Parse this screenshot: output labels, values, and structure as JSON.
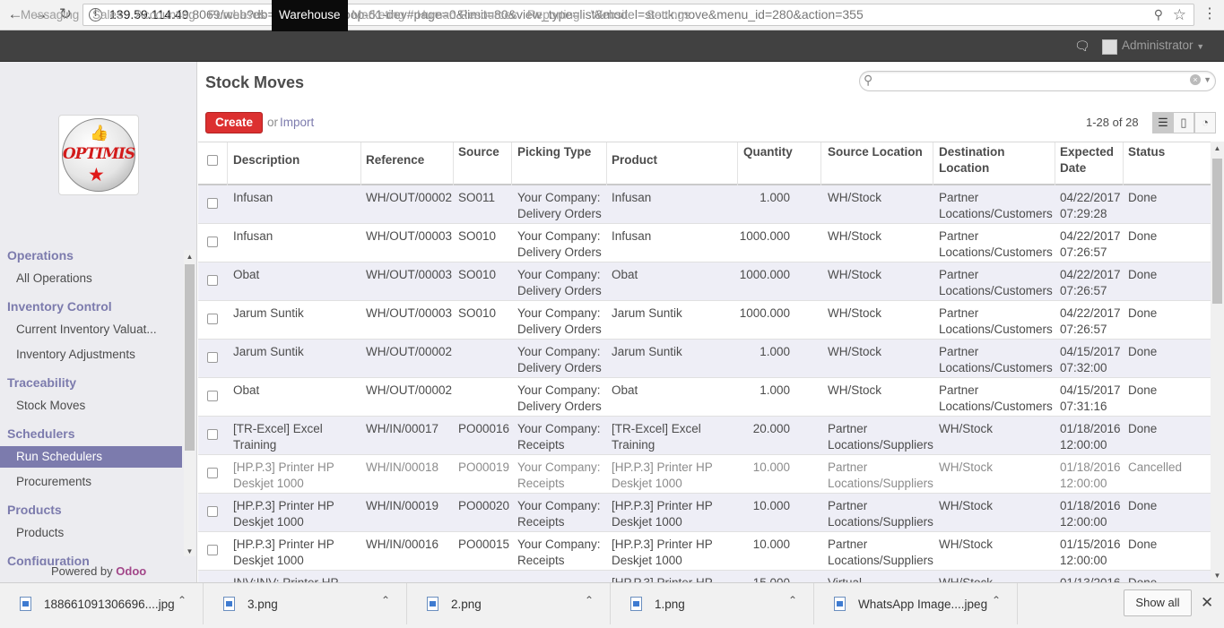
{
  "browser": {
    "url_host": "139.59.114.49",
    "url_rest": ":8069/web?db=o8-uperp10-bop-61-dev#page=0&limit=80&view_type=list&model=stock.move&menu_id=280&action=355"
  },
  "topnav": {
    "items": [
      "Messaging",
      "Sales",
      "Accounting",
      "Purchases",
      "Warehouse",
      "Marketing",
      "Human Resources",
      "Reporting",
      "Website",
      "Settings"
    ],
    "active": "Warehouse",
    "user": "Administrator"
  },
  "sidebar": {
    "logo_text": "OPTIMIS",
    "sections": [
      {
        "title": "Operations",
        "items": [
          "All Operations"
        ]
      },
      {
        "title": "Inventory Control",
        "items": [
          "Current Inventory Valuat...",
          "Inventory Adjustments"
        ]
      },
      {
        "title": "Traceability",
        "items": [
          "Stock Moves"
        ]
      },
      {
        "title": "Schedulers",
        "items": [
          "Run Schedulers",
          "Procurements"
        ]
      },
      {
        "title": "Products",
        "items": [
          "Products"
        ]
      },
      {
        "title": "Configuration",
        "items": []
      }
    ],
    "active_item": "Run Schedulers",
    "powered_by": "Powered by",
    "powered_brand": "Odoo"
  },
  "main": {
    "title": "Stock Moves",
    "create_label": "Create",
    "or_label": "or",
    "import_label": "Import",
    "pager": "1-28 of 28",
    "search_placeholder": ""
  },
  "table": {
    "columns": [
      "Description",
      "Reference",
      "Source",
      "Picking Type",
      "Product",
      "Quantity",
      "Source Location",
      "Destination\nLocation",
      "Expected\nDate",
      "Status"
    ],
    "rows": [
      [
        "Infusan",
        "WH/OUT/00002",
        "SO011",
        "Your Company:\nDelivery Orders",
        "Infusan",
        "1.000",
        "WH/Stock",
        "Partner\nLocations/Customers",
        "04/22/2017\n07:29:28",
        "Done"
      ],
      [
        "Infusan",
        "WH/OUT/00003",
        "SO010",
        "Your Company:\nDelivery Orders",
        "Infusan",
        "1000.000",
        "WH/Stock",
        "Partner\nLocations/Customers",
        "04/22/2017\n07:26:57",
        "Done"
      ],
      [
        "Obat",
        "WH/OUT/00003",
        "SO010",
        "Your Company:\nDelivery Orders",
        "Obat",
        "1000.000",
        "WH/Stock",
        "Partner\nLocations/Customers",
        "04/22/2017\n07:26:57",
        "Done"
      ],
      [
        "Jarum Suntik",
        "WH/OUT/00003",
        "SO010",
        "Your Company:\nDelivery Orders",
        "Jarum Suntik",
        "1000.000",
        "WH/Stock",
        "Partner\nLocations/Customers",
        "04/22/2017\n07:26:57",
        "Done"
      ],
      [
        "Jarum Suntik",
        "WH/OUT/00002",
        "",
        "Your Company:\nDelivery Orders",
        "Jarum Suntik",
        "1.000",
        "WH/Stock",
        "Partner\nLocations/Customers",
        "04/15/2017\n07:32:00",
        "Done"
      ],
      [
        "Obat",
        "WH/OUT/00002",
        "",
        "Your Company:\nDelivery Orders",
        "Obat",
        "1.000",
        "WH/Stock",
        "Partner\nLocations/Customers",
        "04/15/2017\n07:31:16",
        "Done"
      ],
      [
        "[TR-Excel] Excel\nTraining",
        "WH/IN/00017",
        "PO00016",
        "Your Company:\nReceipts",
        "[TR-Excel] Excel\nTraining",
        "20.000",
        "Partner\nLocations/Suppliers",
        "WH/Stock",
        "01/18/2016\n12:00:00",
        "Done"
      ],
      [
        "[HP.P.3] Printer HP\nDeskjet 1000",
        "WH/IN/00018",
        "PO00019",
        "Your Company:\nReceipts",
        "[HP.P.3] Printer HP\nDeskjet 1000",
        "10.000",
        "Partner\nLocations/Suppliers",
        "WH/Stock",
        "01/18/2016\n12:00:00",
        "Cancelled"
      ],
      [
        "[HP.P.3] Printer HP\nDeskjet 1000",
        "WH/IN/00019",
        "PO00020",
        "Your Company:\nReceipts",
        "[HP.P.3] Printer HP\nDeskjet 1000",
        "10.000",
        "Partner\nLocations/Suppliers",
        "WH/Stock",
        "01/18/2016\n12:00:00",
        "Done"
      ],
      [
        "[HP.P.3] Printer HP\nDeskjet 1000",
        "WH/IN/00016",
        "PO00015",
        "Your Company:\nReceipts",
        "[HP.P.3] Printer HP\nDeskjet 1000",
        "10.000",
        "Partner\nLocations/Suppliers",
        "WH/Stock",
        "01/15/2016\n12:00:00",
        "Done"
      ],
      [
        "INV:INV: Printer HP",
        "",
        "",
        "",
        "[HP.P.3] Printer HP",
        "15.000",
        "Virtual",
        "WH/Stock",
        "01/13/2016",
        "Done"
      ]
    ]
  },
  "downloads": {
    "files": [
      "188661091306696....jpg",
      "3.png",
      "2.png",
      "1.png",
      "WhatsApp Image....jpeg"
    ],
    "show_all": "Show all"
  }
}
